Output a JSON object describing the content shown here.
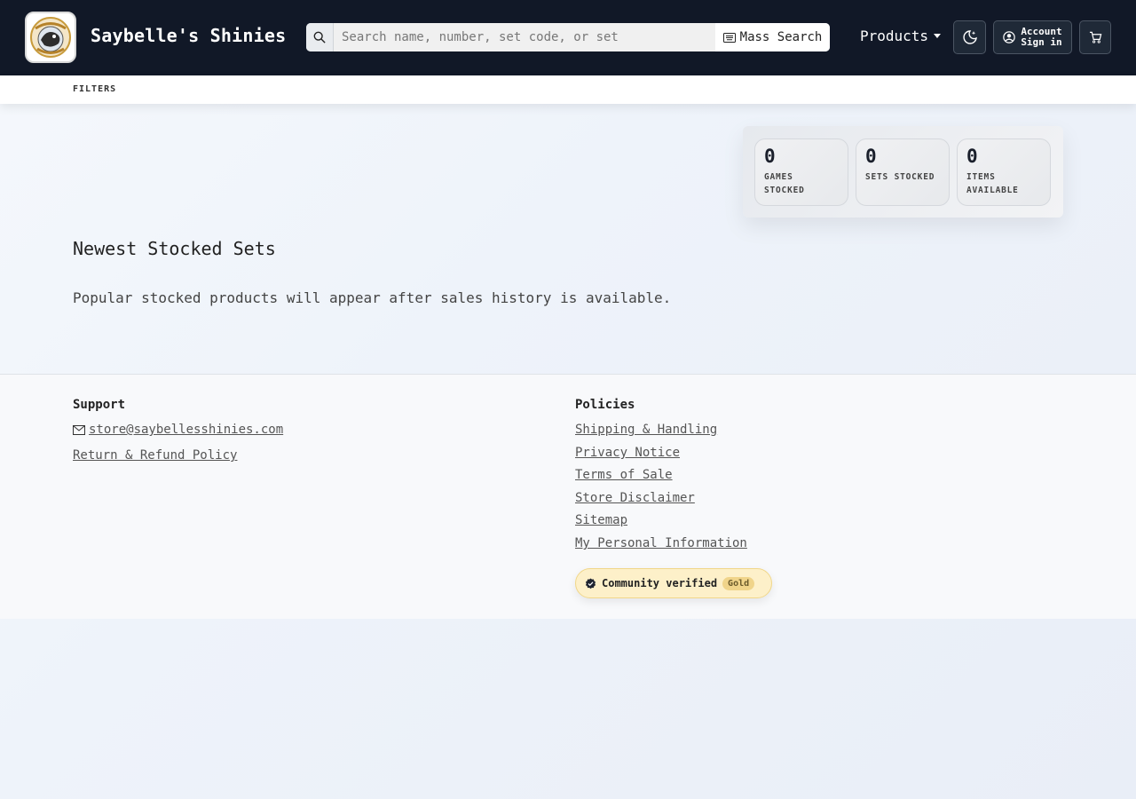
{
  "header": {
    "brand": "Saybelle's Shinies",
    "search_placeholder": "Search name, number, set code, or set",
    "mass_search_label": "Mass Search",
    "products_label": "Products",
    "account_label": "Account",
    "account_sub": "Sign in"
  },
  "filters": {
    "label": "FILTERS"
  },
  "stats": [
    {
      "value": "0",
      "label_line1": "GAMES",
      "label_line2": "STOCKED"
    },
    {
      "value": "0",
      "label_line1": "SETS STOCKED",
      "label_line2": ""
    },
    {
      "value": "0",
      "label_line1": "ITEMS",
      "label_line2": "AVAILABLE"
    }
  ],
  "main": {
    "section_title": "Newest Stocked Sets",
    "section_note": "Popular stocked products will appear after sales history is available."
  },
  "footer": {
    "support": {
      "heading": "Support",
      "email": "store@saybellesshinies.com",
      "refund": "Return & Refund Policy"
    },
    "policies": {
      "heading": "Policies",
      "links": [
        "Shipping & Handling",
        "Privacy Notice",
        "Terms of Sale",
        "Store Disclaimer",
        "Sitemap",
        "My Personal Information"
      ]
    },
    "badge": {
      "text": "Community verified",
      "tag": "Gold"
    }
  },
  "colors": {
    "header_bg": "#111827",
    "badge_bg": "#fdf0c9",
    "badge_tag": "#f0d48a"
  },
  "icons": [
    "search-icon",
    "keyboard-icon",
    "moon-stars-icon",
    "user-circle-icon",
    "cart-icon",
    "envelope-icon",
    "verified-badge-icon"
  ]
}
